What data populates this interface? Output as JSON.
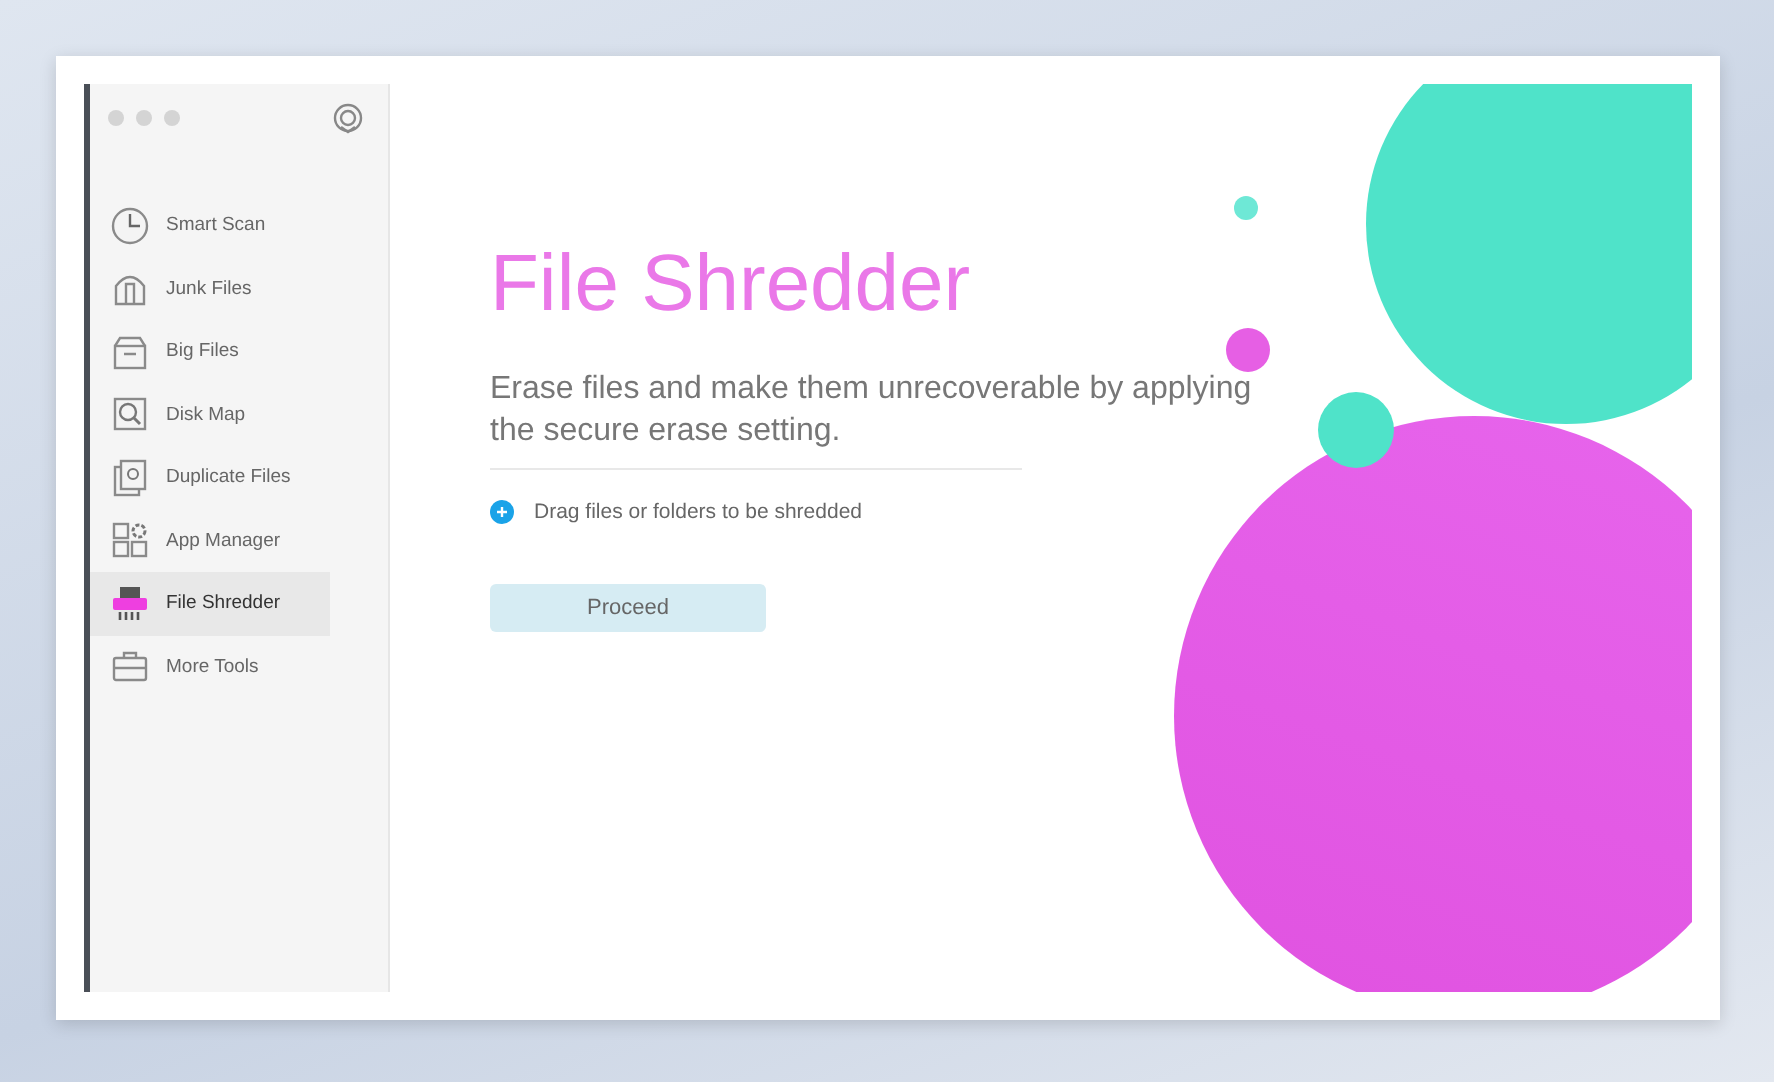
{
  "sidebar": {
    "items": [
      {
        "label": "Smart Scan",
        "selected": false
      },
      {
        "label": "Junk Files",
        "selected": false
      },
      {
        "label": "Big Files",
        "selected": false
      },
      {
        "label": "Disk Map",
        "selected": false
      },
      {
        "label": "Duplicate Files",
        "selected": false
      },
      {
        "label": "App Manager",
        "selected": false
      },
      {
        "label": "File Shredder",
        "selected": true
      },
      {
        "label": "More Tools",
        "selected": false
      }
    ]
  },
  "main": {
    "title": "File Shredder",
    "description": "Erase files and make them unrecoverable by applying the secure erase setting.",
    "drop_hint": "Drag files or folders to be shredded",
    "button": "Proceed"
  }
}
